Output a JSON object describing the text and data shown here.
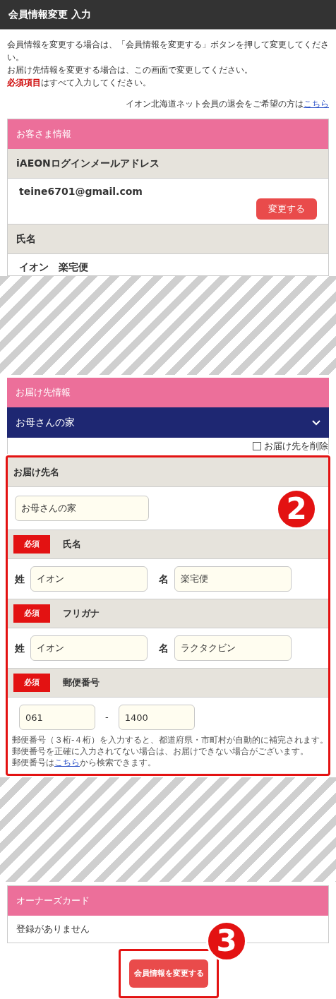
{
  "header": {
    "title": "会員情報変更 入力"
  },
  "intro": [
    "会員情報を変更する場合は、「会員情報を変更する」ボタンを押して変更してください。",
    "お届け先情報を変更する場合は、この画面で変更してください。",
    "**必須項目**はすべて入力してください。"
  ],
  "withdraw": {
    "text": "イオン北海道ネット会員の退会をご希望の方は",
    "link": "こちら"
  },
  "customer": {
    "title": "お客さま情報",
    "rows": [
      {
        "label": "iAEONログインメールアドレス",
        "value": "teine6701@gmail.com",
        "button": "変更する"
      },
      {
        "label": "氏名",
        "value": "イオン　楽宅便"
      }
    ]
  },
  "delivery": {
    "title": "お届け先情報",
    "select": "お母さんの家",
    "delete": {
      "label": "お届け先を削除",
      "checked": false
    },
    "badge": "2",
    "fields": [
      {
        "kind": "single",
        "label": "お届け先名",
        "value": "お母さんの家"
      },
      {
        "kind": "pair",
        "label": "氏名",
        "badge": "必須",
        "parts": [
          {
            "label": "姓",
            "value": "イオン"
          },
          {
            "label": "名",
            "value": "楽宅便"
          }
        ]
      },
      {
        "kind": "pair",
        "label": "フリガナ",
        "badge": "必須",
        "parts": [
          {
            "label": "姓",
            "value": "イオン"
          },
          {
            "label": "名",
            "value": "ラクタクビン"
          }
        ]
      },
      {
        "kind": "postal",
        "label": "郵便番号",
        "badge": "必須",
        "parts": [
          "061",
          "1400"
        ],
        "separator": "-",
        "notes": [
          "郵便番号（３桁-４桁）を入力すると、都道府県・市町村が自動的に補完されます。",
          "郵便番号を正確に入力されてない場合は、お届けできない場合がございます。"
        ],
        "search": {
          "before": "郵便番号は",
          "link": "こちら",
          "after": "から検索できます。"
        }
      }
    ]
  },
  "owners_card": {
    "title": "オーナーズカード",
    "value": "登録がありません"
  },
  "submit": {
    "label": "会員情報を変更する",
    "badge": "3"
  }
}
